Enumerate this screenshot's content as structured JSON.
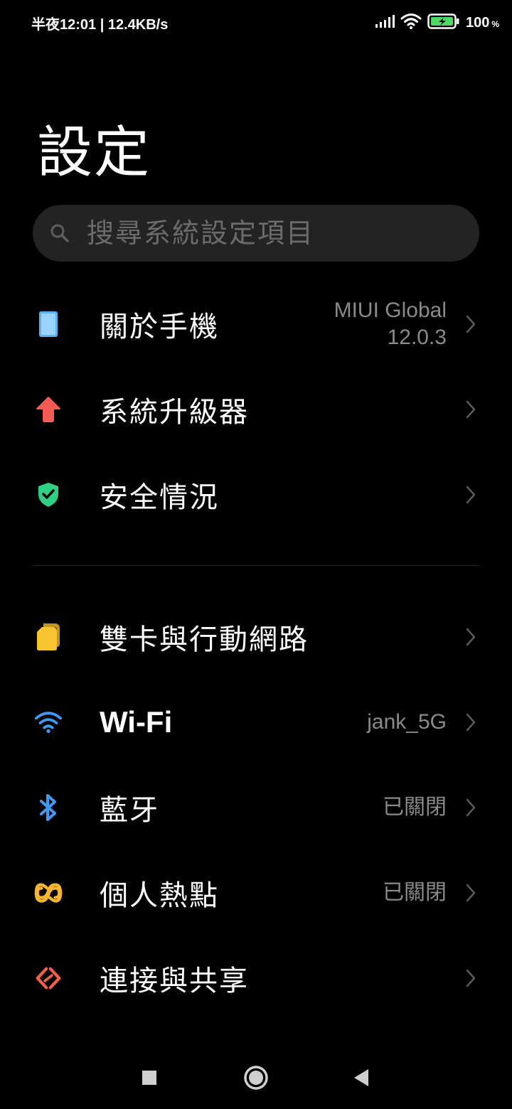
{
  "status_bar": {
    "left_text": "半夜12:01 | 12.4KB/s",
    "battery_percent": "100",
    "battery_unit": "%",
    "battery_level": 100
  },
  "title": "設定",
  "search": {
    "placeholder": "搜尋系統設定項目"
  },
  "colors": {
    "background": "#000000",
    "search_bg": "#232323",
    "secondary_text": "#8a8a8a",
    "battery_green": "#4cd964"
  },
  "items": [
    {
      "label": "關於手機",
      "value_line1": "MIUI Global",
      "value_line2": "12.0.3",
      "icon": "phone-icon",
      "icon_color": "#5ab3f5"
    },
    {
      "label": "系統升級器",
      "value_line1": "",
      "icon": "arrow-up-icon",
      "icon_color": "#f45b52"
    },
    {
      "label": "安全情況",
      "value_line1": "",
      "icon": "shield-check-icon",
      "icon_color": "#2fcf84"
    },
    {
      "label": "雙卡與行動網路",
      "value_line1": "",
      "icon": "sim-card-icon",
      "icon_color": "#f7c431"
    },
    {
      "label": "Wi-Fi",
      "value_line1": "jank_5G",
      "icon": "wifi-icon",
      "icon_color": "#3d9bf5"
    },
    {
      "label": "藍牙",
      "value_line1": "已關閉",
      "icon": "bluetooth-icon",
      "icon_color": "#3d9bf5"
    },
    {
      "label": "個人熱點",
      "value_line1": "已關閉",
      "icon": "hotspot-icon",
      "icon_color": "#f7b631"
    },
    {
      "label": "連接與共享",
      "value_line1": "",
      "icon": "share-connection-icon",
      "icon_color": "#f2603f"
    }
  ],
  "nav": {
    "recents": "square-icon",
    "home": "circle-icon",
    "back": "triangle-back-icon"
  }
}
